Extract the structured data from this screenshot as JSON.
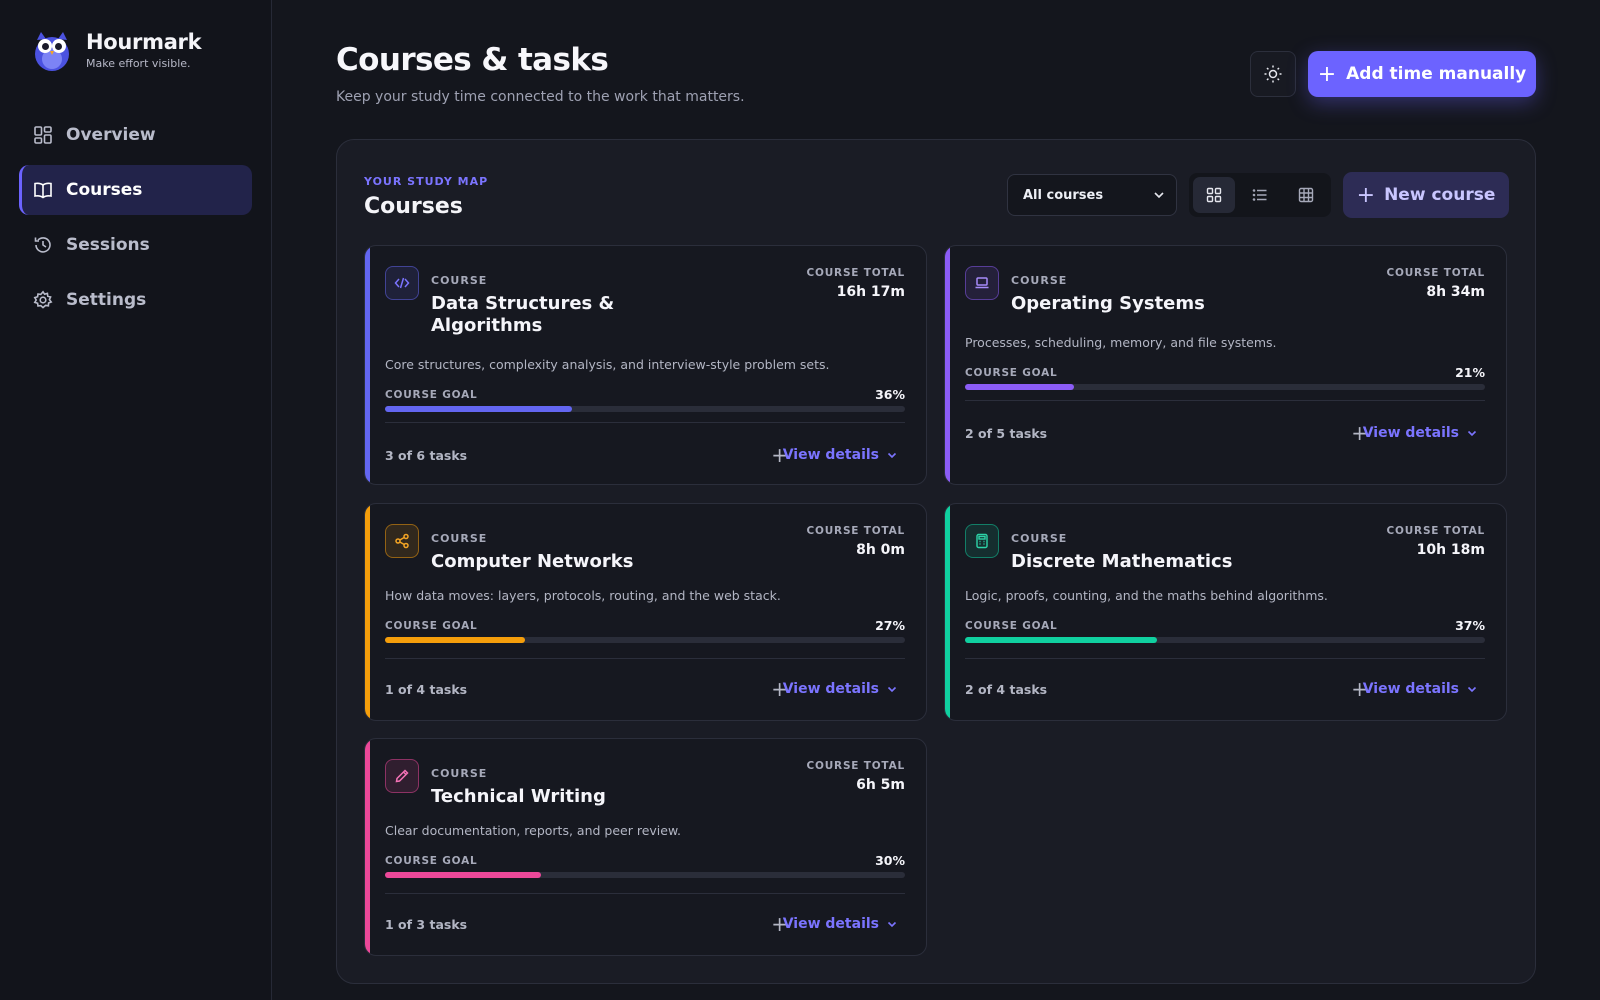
{
  "brand": {
    "name": "Hourmark",
    "tagline": "Make effort visible."
  },
  "nav": [
    {
      "label": "Overview",
      "icon": "dashboard-icon",
      "active": false
    },
    {
      "label": "Courses",
      "icon": "book-icon",
      "active": true
    },
    {
      "label": "Sessions",
      "icon": "history-icon",
      "active": false
    },
    {
      "label": "Settings",
      "icon": "gear-icon",
      "active": false
    }
  ],
  "header": {
    "title": "Courses & tasks",
    "subtitle": "Keep your study time connected to the work that matters.",
    "theme_icon": "sun-icon",
    "add_time_label": "Add time manually"
  },
  "panel": {
    "eyebrow": "YOUR STUDY MAP",
    "title": "Courses",
    "filter_value": "All courses",
    "view_modes": [
      "grid-view-icon",
      "list-view-icon",
      "table-view-icon"
    ],
    "new_course_label": "New course"
  },
  "colors": {
    "accent": "#6c63ff"
  },
  "courses": [
    {
      "kicker": "COURSE",
      "name": "Data Structures & Algorithms",
      "icon": "code-icon",
      "color": "#6366f1",
      "total_label": "COURSE TOTAL",
      "total": "16h 17m",
      "description": "Core structures, complexity analysis, and interview-style problem sets.",
      "goal_label": "COURSE GOAL",
      "goal_pct": "36%",
      "goal": 0.36,
      "tasks": "3 of 6 tasks",
      "view_label": "View details"
    },
    {
      "kicker": "COURSE",
      "name": "Operating Systems",
      "icon": "laptop-icon",
      "color": "#8b5cf6",
      "total_label": "COURSE TOTAL",
      "total": "8h 34m",
      "description": "Processes, scheduling, memory, and file systems.",
      "goal_label": "COURSE GOAL",
      "goal_pct": "21%",
      "goal": 0.21,
      "tasks": "2 of 5 tasks",
      "view_label": "View details"
    },
    {
      "kicker": "COURSE",
      "name": "Computer Networks",
      "icon": "share-icon",
      "color": "#f59e0b",
      "total_label": "COURSE TOTAL",
      "total": "8h 0m",
      "description": "How data moves: layers, protocols, routing, and the web stack.",
      "goal_label": "COURSE GOAL",
      "goal_pct": "27%",
      "goal": 0.27,
      "tasks": "1 of 4 tasks",
      "view_label": "View details"
    },
    {
      "kicker": "COURSE",
      "name": "Discrete Mathematics",
      "icon": "calculator-icon",
      "color": "#10d0a0",
      "total_label": "COURSE TOTAL",
      "total": "10h 18m",
      "description": "Logic, proofs, counting, and the maths behind algorithms.",
      "goal_label": "COURSE GOAL",
      "goal_pct": "37%",
      "goal": 0.37,
      "tasks": "2 of 4 tasks",
      "view_label": "View details"
    },
    {
      "kicker": "COURSE",
      "name": "Technical Writing",
      "icon": "pencil-icon",
      "color": "#ec4899",
      "total_label": "COURSE TOTAL",
      "total": "6h 5m",
      "description": "Clear documentation, reports, and peer review.",
      "goal_label": "COURSE GOAL",
      "goal_pct": "30%",
      "goal": 0.3,
      "tasks": "1 of 3 tasks",
      "view_label": "View details"
    }
  ]
}
